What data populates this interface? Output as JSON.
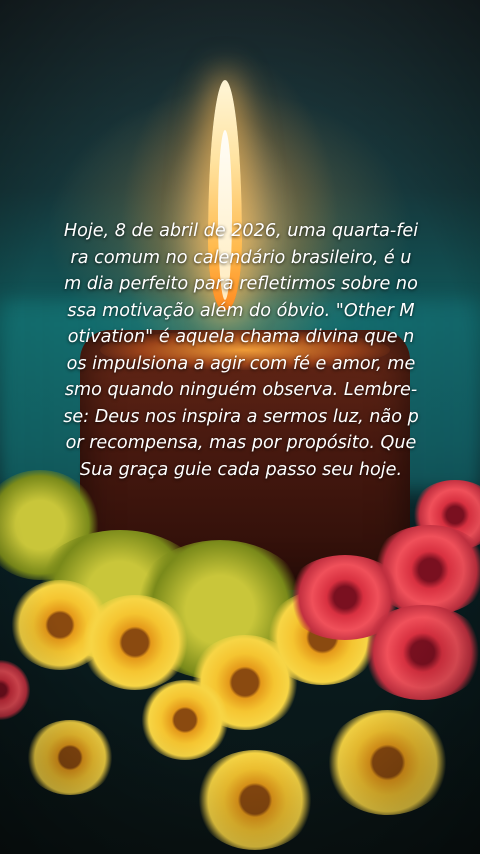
{
  "caption": {
    "lines": [
      "Hoje, 8 de abril de 2026, uma quarta-fei",
      "ra comum no calendário brasileiro, é u",
      "m dia perfeito para refletirmos sobre no",
      "ssa motivação além do óbvio. \"Other M",
      "otivation\" é aquela chama divina que n",
      "os impulsiona a agir com fé e amor, me",
      "smo quando ninguém observa. Lembre-",
      "se: Deus nos inspira a sermos luz, não p",
      "or recompensa, mas por propósito. Que",
      "Sua graça guie cada passo seu hoje."
    ]
  },
  "colors": {
    "text": "#ffffff",
    "flame": "#ffd27a",
    "candle": "#4a1a10",
    "background_teal": "#0f5a5c"
  }
}
